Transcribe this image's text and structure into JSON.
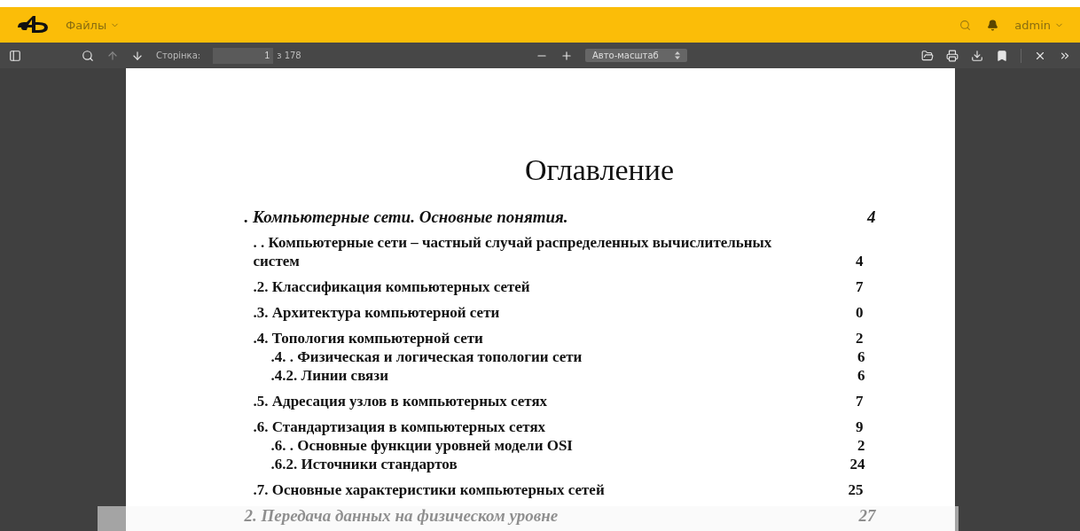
{
  "header": {
    "menu": "Файлы",
    "user": "admin"
  },
  "toolbar": {
    "page_label": "Сторінка:",
    "page_value": "1",
    "page_count": "з 178",
    "zoom": "Авто-масштаб"
  },
  "document": {
    "title": "Оглавление",
    "chapters": [
      {
        "title": ". Компьютерные сети. Основные понятия.",
        "page": "4",
        "children": [
          {
            "title": ". . Компьютерные сети – частный случай распределенных вычислительных систем",
            "page": "4"
          },
          {
            "title": ".2. Классификация компьютерных сетей",
            "page": "7"
          },
          {
            "title": ".3. Архитектура компьютерной сети",
            "page": "0"
          },
          {
            "title": ".4. Топология компьютерной сети",
            "page": "2",
            "children": [
              {
                "title": ".4.  . Физическая и логическая топологии сети",
                "page": "6"
              },
              {
                "title": ".4.2. Линии связи",
                "page": "6"
              }
            ]
          },
          {
            "title": ".5. Адресация узлов в компьютерных сетях",
            "page": "7"
          },
          {
            "title": ".6. Стандартизация в компьютерных сетях",
            "page": "9",
            "children": [
              {
                "title": ".6.  . Основные функции уровней модели OSI",
                "page": "2"
              },
              {
                "title": ".6.2. Источники стандартов",
                "page": "24"
              }
            ]
          },
          {
            "title": ".7. Основные характеристики компьютерных сетей",
            "page": "25"
          }
        ]
      },
      {
        "title": "2. Передача данных на физическом уровне",
        "page": "27"
      }
    ]
  }
}
